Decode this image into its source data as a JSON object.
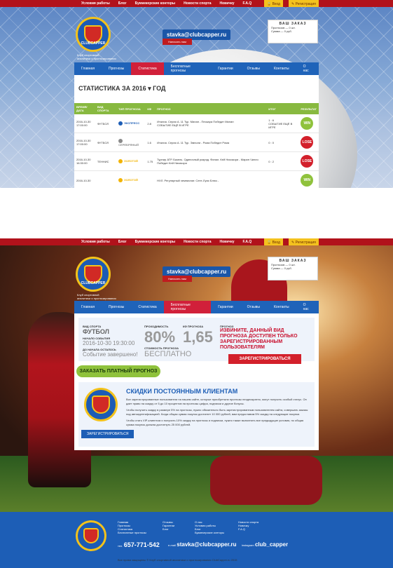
{
  "nav_top": [
    "Условия работы",
    "Блог",
    "Букмекерские конторы",
    "Новости спорта",
    "Новичку",
    "F.A.Q"
  ],
  "auth": {
    "login": "Вход",
    "register": "Регистрация"
  },
  "header": {
    "logo_text": "CLUBCAPPER",
    "tagline_1": "Клуб спортивной",
    "tagline_2": "аналитики и прогнозирования",
    "email": "stavka@clubcapper.ru",
    "write_btn": "Написать нам",
    "receipt_title": "ВАШ ЗАКАЗ",
    "receipt_line1": "Прогнозов — 0 шт.",
    "receipt_line2": "Сумма — 0 руб."
  },
  "main_nav": [
    "Главная",
    "Прогнозы",
    "Статистика",
    "Бесплатные прогнозы",
    "Гарантии",
    "Отзывы",
    "Контакты",
    "О нас"
  ],
  "stats": {
    "title": "СТАТИСТИКА ЗА  2016 ▾  ГОД",
    "columns": [
      "ВРЕМЯ/ДАТА",
      "ВИД СПОРТА",
      "ТИП ПРОГНОЗА",
      "КФ",
      "ПРОГНОЗ",
      "ИТОГ",
      "РЕЗУЛЬТАТ"
    ],
    "rows": [
      {
        "date": "2016-10-30",
        "time": "17:00:00",
        "sport": "ФУТБОЛ",
        "type": "ЭКСПРЕСС",
        "type_color": "#1d5eb6",
        "kf": "2.8",
        "forecast": "Италия. Серия А. 11 Тур. Милан - Пескара Победит Милан",
        "forecast2": "СОБЫТИЕ ЕЩЁ В ИГРЕ",
        "itog": "1 : 6",
        "itog2": "СОБЫТИЕ ЕЩЁ В ИГРЕ",
        "result": "WIN"
      },
      {
        "date": "2016-10-30",
        "time": "17:00:00",
        "sport": "ФУТБОЛ",
        "type": "СЕРЕБРЯНЫЙ",
        "type_color": "#8a8a8a",
        "kf": "1.6",
        "forecast": "Италия. Серия А. 11 Тур. Эмполи - Рома Победит Рома",
        "forecast2": "",
        "itog": "0 : 0",
        "itog2": "",
        "result": "LOSE"
      },
      {
        "date": "2016-10-30",
        "time": "16:30:00",
        "sport": "ТЕННИС",
        "type": "ЗОЛОТОЙ",
        "type_color": "#f2b300",
        "kf": "1.75",
        "forecast": "Турнир АТР. Базель. Одиночный разряд. Финал. Кей Нисикори - Марин Чилич Победит Кей Нисикори",
        "forecast2": "",
        "itog": "0 : 2",
        "itog2": "",
        "result": "LOSE"
      },
      {
        "date": "2016-10-30",
        "time": "",
        "sport": "",
        "type": "ЗОЛОТОЙ",
        "type_color": "#f2b300",
        "kf": "",
        "forecast": "НХЛ. Регулярный чемпионат. Сент-Луис Блюз -",
        "forecast2": "",
        "itog": "",
        "itog2": "",
        "result": "WIN"
      }
    ]
  },
  "free": {
    "sport_label": "ВИД СПОРТА",
    "sport": "ФУТБОЛ",
    "start_label": "НАЧАЛО СОБЫТИЯ",
    "start": "2016-10-30 19:30:00",
    "left_label": "ДО НАЧАЛА ОСТАЛОСЬ",
    "left": "Событие завершено!",
    "pass_label": "ПРОХОДИМОСТЬ",
    "pass": "80%",
    "kf_label": "КФ ПРОГНОЗА",
    "kf": "1,65",
    "price_label": "СТОИМОСТЬ ПРОГНОЗА",
    "price": "БЕСПЛАТНО",
    "forecast_label": "ПРОГНОЗ",
    "warning": "ИЗВИНИТЕ, ДАННЫЙ ВИД ПРОГНОЗА ДОСТУПЕН ТОЛЬКО ЗАРЕГИСТРИРОВАННЫМ ПОЛЬЗОВАТЕЛЯМ",
    "register": "ЗАРЕГИСТРИРОВАТЬСЯ",
    "order": "ЗАКАЗАТЬ ПЛАТНЫЙ ПРОГНОЗ"
  },
  "discount": {
    "title": "СКИДКИ ПОСТОЯННЫМ КЛИЕНТАМ",
    "p1": "Все зарегистрированные пользователи на нашем сайте, которые приобретали прогнозы неоднократно, могут получить особый статус. Он дает право на скидку от 5 до 10 процентов на прогнозы цифра, подписки и другие бонусы.",
    "p2": "Чтобы получить скидку в размере 5% на прогнозы, нужно обязательно быть зарегистрированным пользователем сайта, совершать заказы под автоидентификацией. Когда общая сумма покупок достигнет 10 000 рублей, вам предоставим 5% скидку на следующие покупки.",
    "p3": "Чтобы стать VIP-клиентом и получить 10% скидку на прогнозы и подписки, нужно также выполнить все предыдущие условия, но общая сумма покупок должна достигнуть 25 000 рублей.",
    "register": "ЗАРЕГИСТРИРОВАТЬСЯ"
  },
  "footer": {
    "col1": [
      "Главная",
      "Прогнозы",
      "Статистика",
      "Бесплатные прогнозы"
    ],
    "col2": [
      "Отзывы",
      "Гарантии",
      "Блог"
    ],
    "col3": [
      "О нас",
      "Условия работы",
      "Блог",
      "Букмекерские конторы"
    ],
    "col4": [
      "Новости спорта",
      "Новичку",
      "F.A.Q"
    ],
    "phone_label": "тел.",
    "phone": "657-771-542",
    "mail_label": "e-mail",
    "email": "stavka@clubcapper.ru",
    "insta_label": "instagram",
    "insta": "club_capper",
    "copyright": "Все права защищены © Клуб спортивной аналитики и прогнозирования ClubCapper.ru 2015"
  }
}
